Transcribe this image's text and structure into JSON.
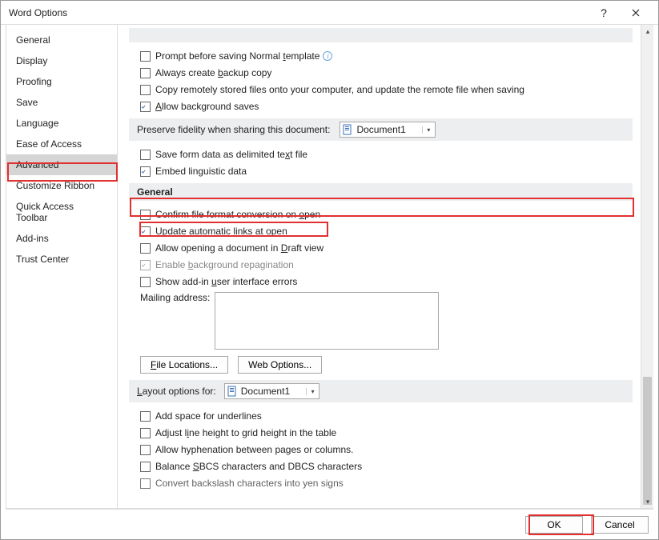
{
  "dialog": {
    "title": "Word Options"
  },
  "sidebar": {
    "items": [
      {
        "label": "General"
      },
      {
        "label": "Display"
      },
      {
        "label": "Proofing"
      },
      {
        "label": "Save"
      },
      {
        "label": "Language"
      },
      {
        "label": "Ease of Access"
      },
      {
        "label": "Advanced",
        "selected": true
      },
      {
        "label": "Customize Ribbon"
      },
      {
        "label": "Quick Access Toolbar"
      },
      {
        "label": "Add-ins"
      },
      {
        "label": "Trust Center"
      }
    ]
  },
  "save_section": {
    "opt_prompt_normal": {
      "text_pre": "Prompt before saving Normal ",
      "u": "t",
      "text_post": "emplate",
      "checked": false,
      "info": true
    },
    "opt_backup": {
      "text_pre": "Always create ",
      "u": "b",
      "text_post": "ackup copy",
      "checked": false
    },
    "opt_copy_remote": {
      "text": "Copy remotely stored files onto your computer, and update the remote file when saving",
      "checked": false
    },
    "opt_bg_saves": {
      "text_pre": "",
      "u": "A",
      "text_post": "llow background saves",
      "checked": true
    }
  },
  "preserve_section": {
    "heading": "Preserve fidelity when sharing this document:",
    "doc": "Document1",
    "opt_save_form": {
      "text_pre": "Save form data as delimited te",
      "u": "x",
      "text_post": "t file",
      "checked": false
    },
    "opt_embed_ling": {
      "text": "Embed linguistic data",
      "checked": true
    }
  },
  "general_section": {
    "heading": "General",
    "opt_confirm_conv": {
      "text_pre": "Confirm file format conversion on ",
      "u": "o",
      "text_post": "pen",
      "checked": false
    },
    "opt_update_links": {
      "text": "Update automatic links at open",
      "checked": true
    },
    "opt_draft_view": {
      "text_pre": "Allow opening a document in ",
      "u": "D",
      "text_post": "raft view",
      "checked": false
    },
    "opt_bg_repag": {
      "text_pre": "Enable ",
      "u": "b",
      "text_post": "ackground repagination",
      "checked": true,
      "disabled": true
    },
    "opt_addin_err": {
      "text_pre": "Show add-in ",
      "u": "u",
      "text_post": "ser interface errors",
      "checked": false
    },
    "mailing_label": "Mailing address:",
    "mailing_value": "",
    "btn_file_loc": "File Locations...",
    "btn_web_opt": "Web Options..."
  },
  "layout_section": {
    "heading_pre": "",
    "heading_u": "L",
    "heading_post": "ayout options for:",
    "doc": "Document1",
    "opts": [
      {
        "text": "Add space for underlines"
      },
      {
        "text_pre": "Adjust l",
        "u": "i",
        "text_post": "ne height to grid height in the table"
      },
      {
        "text": "Allow hyphenation between pages or columns."
      },
      {
        "text_pre": "Balance ",
        "u": "S",
        "text_post": "BCS characters and DBCS characters"
      },
      {
        "text": "Convert backslash characters into yen signs"
      }
    ]
  },
  "footer": {
    "ok": "OK",
    "cancel": "Cancel"
  }
}
